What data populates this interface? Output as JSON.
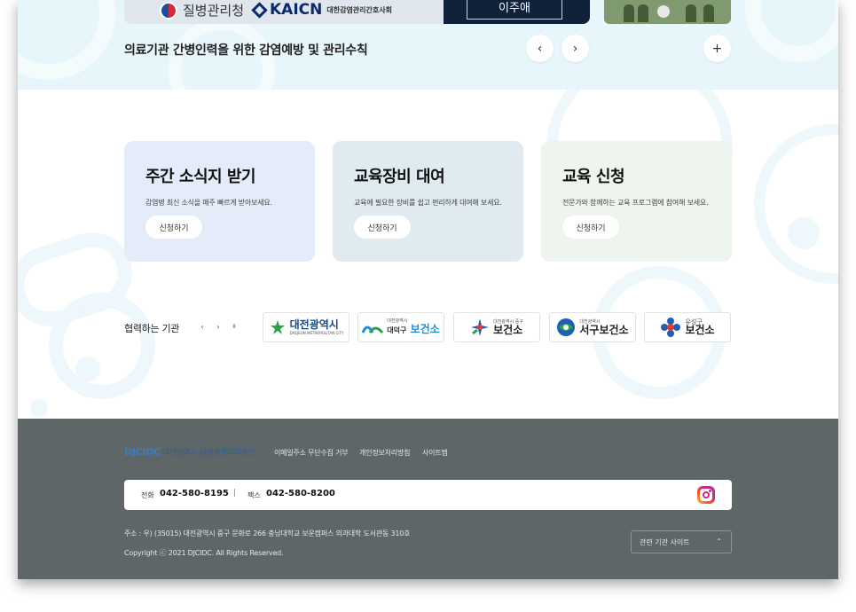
{
  "hero": {
    "banner_main": {
      "logo_kdca": "질병관리청",
      "logo_kaicn": "KAICN",
      "logo_kaicn_sub": "대한감염관리간호사회",
      "speaker": "이주애"
    },
    "title": "의료기관 간병인력을 위한 감염예방 및 관리수칙",
    "prev_icon": "‹",
    "next_icon": "›",
    "more_icon": "+"
  },
  "cards": [
    {
      "title": "주간 소식지 받기",
      "desc": "감염병 최신 소식을 매주 빠르게 받아보세요.",
      "button": "신청하기",
      "bg": "#e3ecf8"
    },
    {
      "title": "교육장비 대여",
      "desc": "교육에 필요한 장비를 쉽고 편리하게 대여해 보세요.",
      "button": "신청하기",
      "bg": "#dfeaf1"
    },
    {
      "title": "교육 신청",
      "desc": "전문가와 함께하는 교육 프로그램에 참여해 보세요.",
      "button": "신청하기",
      "bg": "#eef5ee"
    }
  ],
  "partners": {
    "label": "협력하는 기관",
    "prev": "‹",
    "next": "›",
    "pause": "II",
    "items": [
      {
        "small": "DAEJEON METROPOLITAN CITY",
        "name": "대전광역시",
        "color": "#0d4a8f"
      },
      {
        "small": "대전광역시",
        "name_pre": "대덕구",
        "name": "보건소",
        "color": "#1e8fd6"
      },
      {
        "small": "대전광역시 중구",
        "name": "보건소",
        "color": "#222222"
      },
      {
        "small": "대전광역시",
        "name": "서구보건소",
        "color": "#222222"
      },
      {
        "small": "유성구",
        "name": "보건소",
        "color": "#222222"
      }
    ]
  },
  "footer": {
    "logo_en": "DJCIDC",
    "logo_ko": "대전광역시 감염병관리지원단",
    "links": [
      "이메일주소 무단수집 거부",
      "개인정보처리방침",
      "사이트맵"
    ],
    "tel_label": "전화",
    "tel": "042-580-8195",
    "sep": "|",
    "fax_label": "팩스",
    "fax": "042-580-8200",
    "address": "주소 : 우) (35015) 대전광역시 중구 문화로 266 충남대학교 보운캠퍼스 의과대학 도서관동 310호",
    "copyright": "Copyright ⓒ 2021 DJCIDC. All Rights Reserved.",
    "related_sites": "관련 기관 사이트",
    "related_chevron": "⌃"
  }
}
